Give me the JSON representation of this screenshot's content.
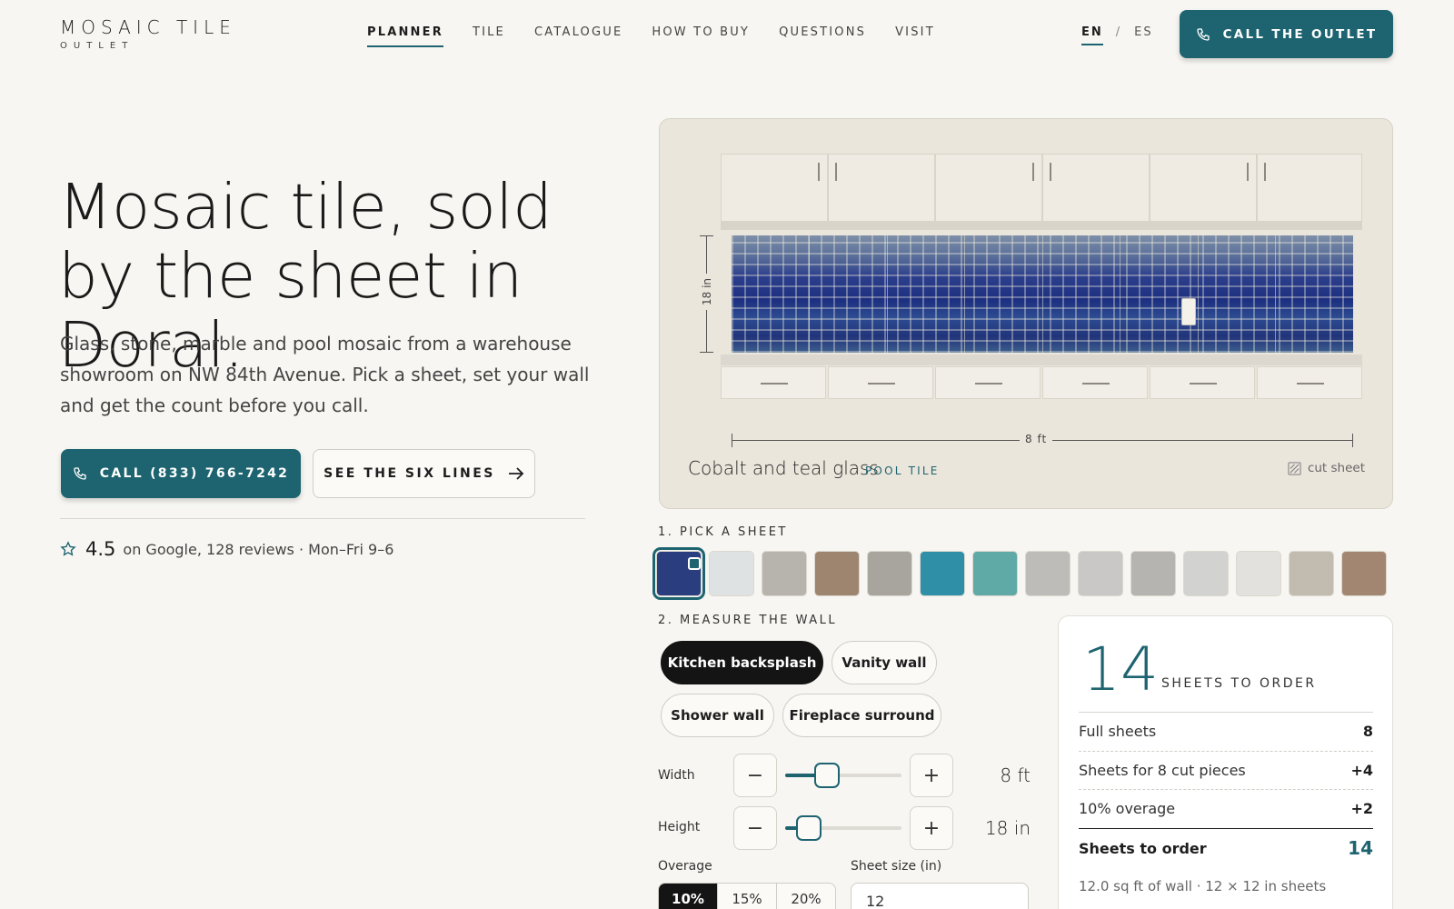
{
  "brand": {
    "name": "MOSAIC TILE",
    "sub": "OUTLET"
  },
  "nav": [
    {
      "label": "PLANNER",
      "active": true
    },
    {
      "label": "TILE"
    },
    {
      "label": "CATALOGUE"
    },
    {
      "label": "HOW TO BUY"
    },
    {
      "label": "QUESTIONS"
    },
    {
      "label": "VISIT"
    }
  ],
  "lang": {
    "en": "EN",
    "sep": "/",
    "es": "ES"
  },
  "header_cta": "CALL THE OUTLET",
  "hero": {
    "title": "Mosaic tile, sold by the sheet in Doral.",
    "description": "Glass, stone, marble and pool mosaic from a warehouse showroom on NW 84th Avenue. Pick a sheet, set your wall and get the count before you call.",
    "call_button": "CALL (833) 766-7242",
    "lines_button": "SEE THE SIX LINES"
  },
  "rating": {
    "score": "4.5",
    "text": "on Google, 128 reviews · Mon–Fri 9–6"
  },
  "preview": {
    "height_label": "18 in",
    "width_label": "8 ft",
    "tile_name": "Cobalt and teal glass",
    "tile_category": "POOL TILE",
    "cut_sheet": "cut sheet"
  },
  "pick_sheet": {
    "label": "1. PICK A SHEET",
    "swatches": [
      {
        "name": "cobalt-glass",
        "color": "#2a3d7e",
        "selected": true
      },
      {
        "name": "white-marble",
        "color": "#dfe2e3"
      },
      {
        "name": "grey-stone-strip",
        "color": "#b7b4ad"
      },
      {
        "name": "rustic-stone",
        "color": "#9d8570"
      },
      {
        "name": "grey-brick",
        "color": "#a8a59e"
      },
      {
        "name": "teal-pool",
        "color": "#2f8fa7"
      },
      {
        "name": "aqua-glass",
        "color": "#5faaa6"
      },
      {
        "name": "herringbone-grey",
        "color": "#bdbcb9"
      },
      {
        "name": "hexagon-grey",
        "color": "#c9c8c6"
      },
      {
        "name": "chevron-grey",
        "color": "#b5b4b1"
      },
      {
        "name": "lattice-white",
        "color": "#d2d2d0"
      },
      {
        "name": "herringbone-white",
        "color": "#e2e1de"
      },
      {
        "name": "diagonal-stone",
        "color": "#c1bcaf"
      },
      {
        "name": "woven-brown",
        "color": "#a28672"
      }
    ]
  },
  "measure": {
    "label": "2. MEASURE THE WALL",
    "presets": [
      {
        "label": "Kitchen backsplash",
        "selected": true
      },
      {
        "label": "Vanity wall"
      },
      {
        "label": "Shower wall"
      },
      {
        "label": "Fireplace surround"
      }
    ],
    "width": {
      "label": "Width",
      "value": "8 ft",
      "fraction": 0.36,
      "minus": "−",
      "plus": "+"
    },
    "height": {
      "label": "Height",
      "value": "18 in",
      "fraction": 0.2,
      "minus": "−",
      "plus": "+"
    },
    "overage": {
      "label": "Overage",
      "options": [
        "10%",
        "15%",
        "20%"
      ],
      "selected": "10%"
    },
    "sheet_size": {
      "label": "Sheet size (in)",
      "value": "12"
    }
  },
  "summary": {
    "count": "14",
    "count_label": "SHEETS TO ORDER",
    "rows": [
      {
        "label": "Full sheets",
        "value": "8"
      },
      {
        "label": "Sheets for 8 cut pieces",
        "value": "+4"
      },
      {
        "label": "10% overage",
        "value": "+2"
      }
    ],
    "total_label": "Sheets to order",
    "total_value": "14",
    "footnote": "12.0 sq ft of wall · 12 × 12 in sheets"
  },
  "colors": {
    "accent": "#1e6470",
    "dark": "#141414",
    "background": "#f7f6f2"
  }
}
